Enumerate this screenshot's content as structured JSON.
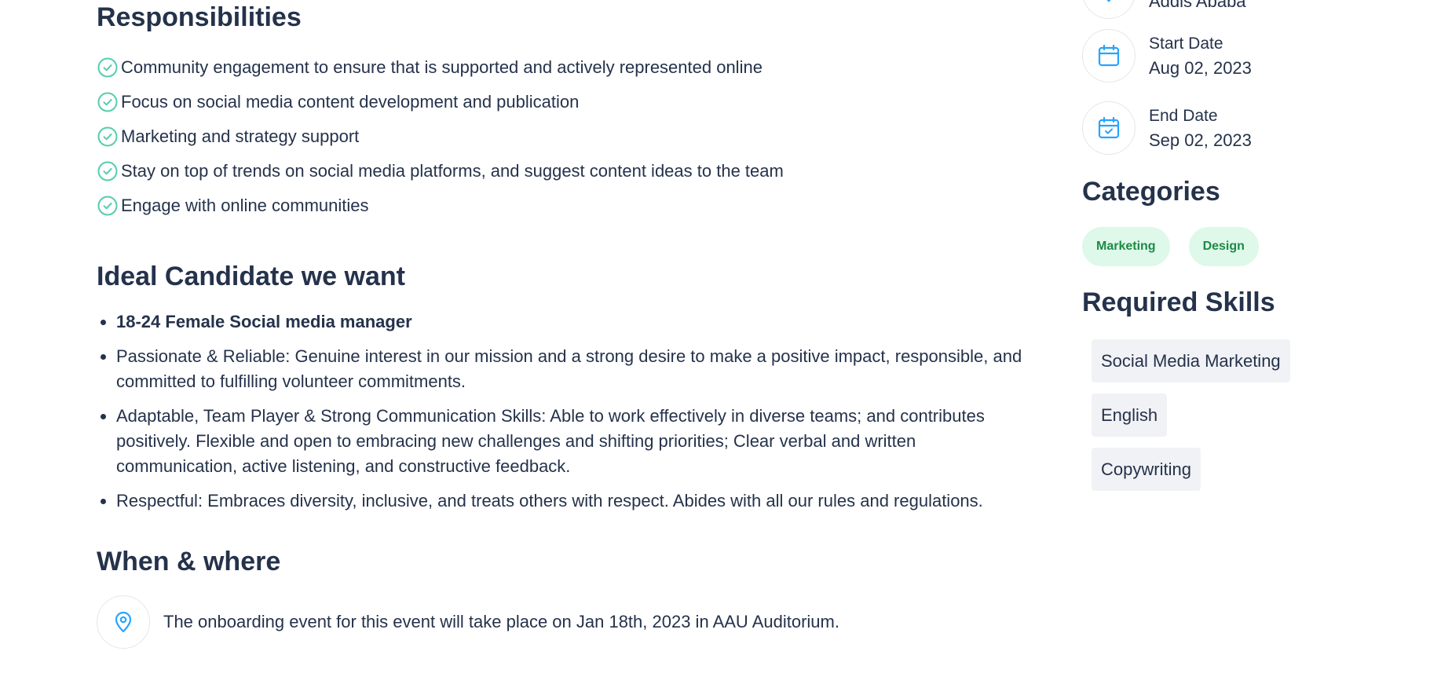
{
  "responsibilities": {
    "title": "Responsibilities",
    "items": [
      "Community engagement to ensure that is supported and actively represented online",
      "Focus on social media content development and publication",
      "Marketing and strategy support",
      "Stay on top of trends on social media platforms, and suggest content ideas to the team",
      "Engage with online communities"
    ]
  },
  "ideal_candidate": {
    "title": "Ideal Candidate we want",
    "items": [
      "18-24 Female Social media manager",
      "Passionate & Reliable: Genuine interest in our mission and a strong desire to make a positive impact, responsible, and committed to fulfilling volunteer commitments.",
      "Adaptable, Team Player & Strong Communication Skills: Able to work effectively in diverse teams; and contributes positively. Flexible and open to embracing new challenges and shifting priorities; Clear verbal and written communication, active listening, and constructive feedback.",
      "Respectful: Embraces diversity, inclusive, and treats others with respect. Abides with all our rules and regulations."
    ]
  },
  "when_where": {
    "title": "When & where",
    "text": "The onboarding event for this event will take place on Jan 18th, 2023 in AAU Auditorium."
  },
  "sidebar": {
    "location": {
      "value": "Addis Ababa"
    },
    "start_date": {
      "label": "Start Date",
      "value": "Aug 02, 2023"
    },
    "end_date": {
      "label": "End Date",
      "value": "Sep 02, 2023"
    },
    "categories": {
      "title": "Categories",
      "items": [
        "Marketing",
        "Design"
      ]
    },
    "required_skills": {
      "title": "Required Skills",
      "items": [
        "Social Media Marketing",
        "English",
        "Copywriting"
      ]
    }
  },
  "icons": {
    "check": "check-circle-icon",
    "location": "location-pin-icon",
    "calendar": "calendar-icon",
    "calendar_check": "calendar-check-icon"
  },
  "colors": {
    "heading": "#25324b",
    "check_green": "#56cdad",
    "icon_blue": "#26a4ff",
    "category_bg": "#def8ea",
    "category_text": "#1d8a45",
    "skill_bg": "#f1f2f5"
  }
}
